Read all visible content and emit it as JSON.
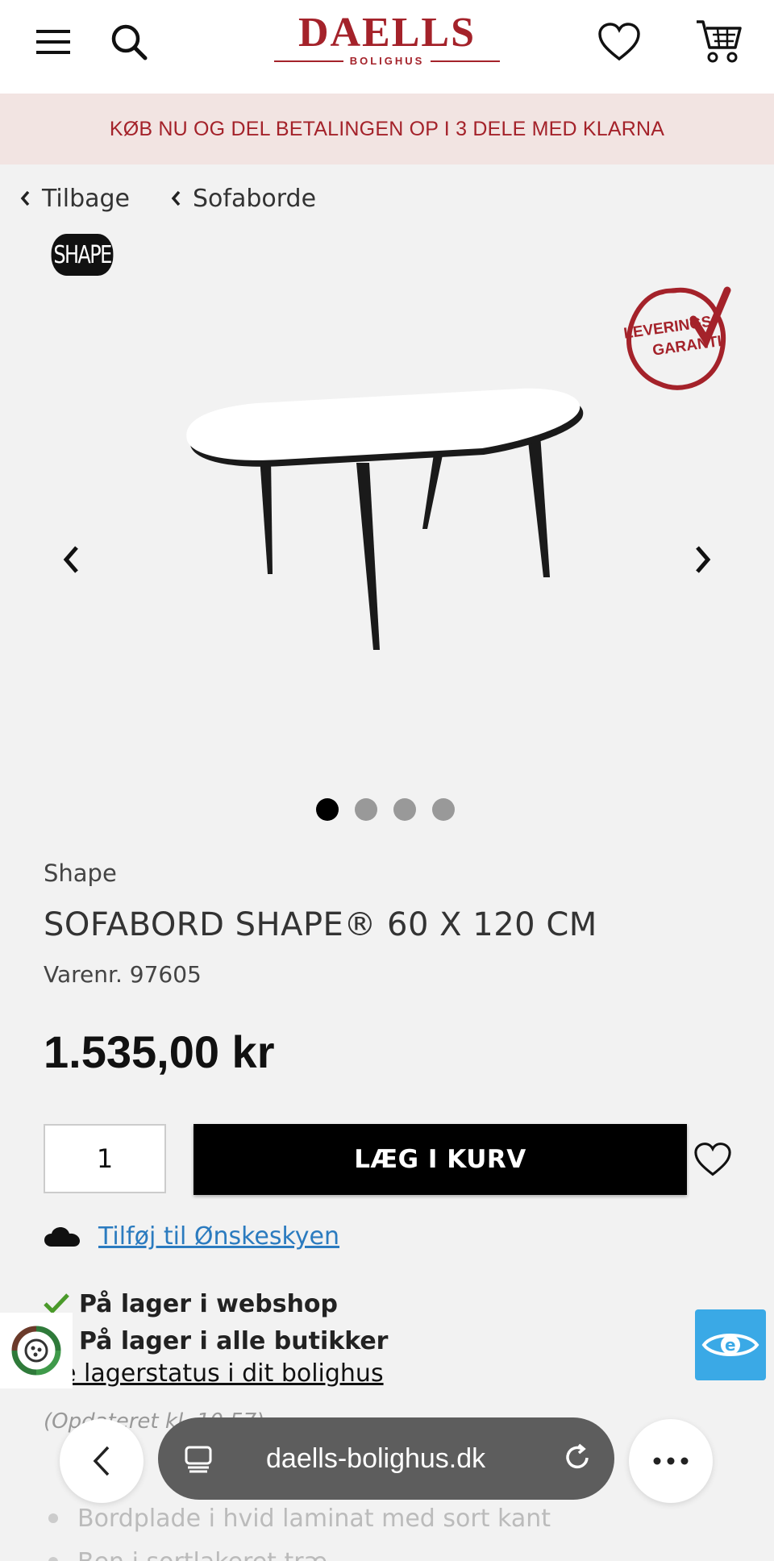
{
  "header": {
    "logo_main": "DAELLS",
    "logo_sub": "BOLIGHUS",
    "icons": [
      "menu-icon",
      "search-icon",
      "heart-icon",
      "cart-icon"
    ]
  },
  "promo": {
    "text": "KØB NU OG DEL BETALINGEN OP I 3 DELE MED KLARNA"
  },
  "breadcrumb": {
    "back_label": "Tilbage",
    "category_label": "Sofaborde"
  },
  "brand_logo_text": "SHAPE",
  "stamp": {
    "line1": "LEVERINGS",
    "line2": "GARANTI"
  },
  "gallery": {
    "image_count": 4,
    "active_index": 0
  },
  "product": {
    "brand": "Shape",
    "title": "SOFABORD SHAPE® 60 X 120 CM",
    "sku": "Varenr. 97605",
    "price": "1.535,00 kr"
  },
  "cart": {
    "quantity": "1",
    "add_label": "LÆG I KURV"
  },
  "wishcloud": {
    "label": "Tilføj til Ønskeskyen"
  },
  "stock": {
    "webshop": "På lager i webshop",
    "stores": "På lager i alle butikker",
    "link": "e lagerstatus i dit bolighus"
  },
  "updated": "(Opdateret kl. 10.57)",
  "features": [
    "Bordplade i hvid laminat med sort kant",
    "Ben i sortlakeret træ"
  ],
  "browser": {
    "url": "daells-bolighus.dk"
  },
  "colors": {
    "brand_red": "#a4222a",
    "promo_bg": "#f2e4e2",
    "link_blue": "#2b7bbf",
    "check_green": "#4a9a2a",
    "access_blue": "#3aa9e6"
  }
}
